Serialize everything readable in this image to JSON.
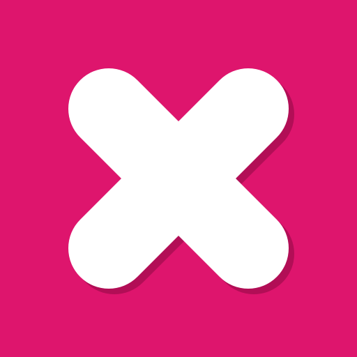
{
  "icon": {
    "name": "close-icon",
    "background_color": "#de156d",
    "glyph_color": "#ffffff",
    "shadow_color": "#b20e56"
  }
}
